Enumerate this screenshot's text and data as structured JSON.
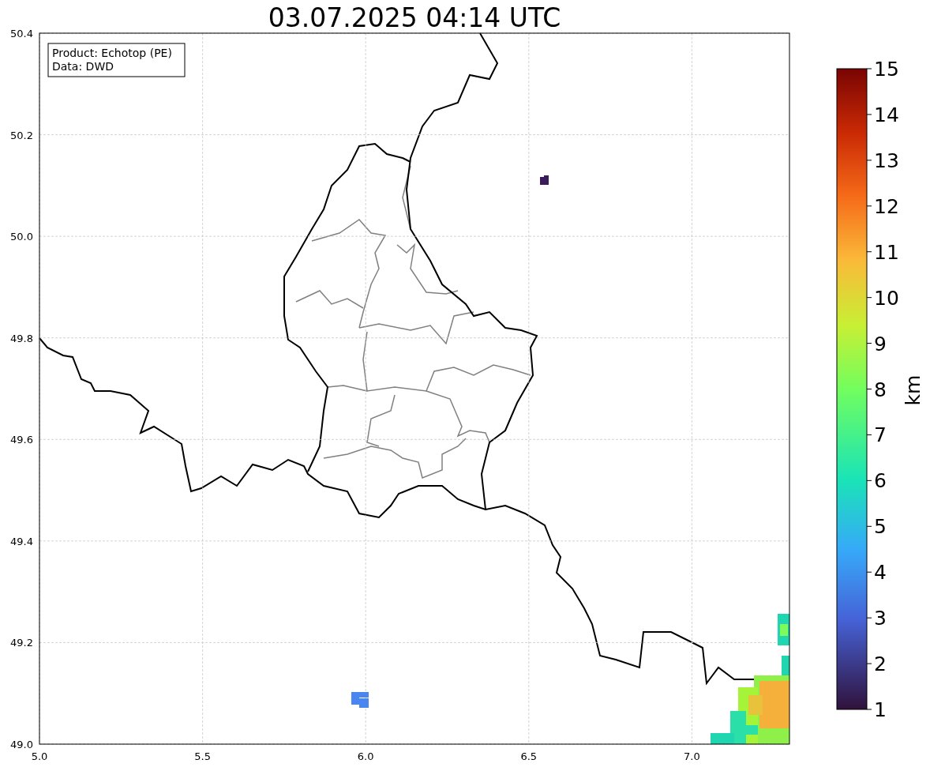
{
  "title": "03.07.2025 04:14 UTC",
  "info_box": [
    "Product: Echotop (PE)",
    "Data: DWD"
  ],
  "map": {
    "xticks": [
      "5.0",
      "5.5",
      "6.0",
      "6.5",
      "7.0"
    ],
    "yticks": [
      "50.4",
      "50.2",
      "50.0",
      "49.8",
      "49.6",
      "49.4",
      "49.2",
      "49.0"
    ]
  },
  "colorbar": {
    "ticks": [
      "15",
      "14",
      "13",
      "12",
      "11",
      "10",
      "9",
      "8",
      "7",
      "6",
      "5",
      "4",
      "3",
      "2",
      "1"
    ],
    "label": "km"
  }
}
